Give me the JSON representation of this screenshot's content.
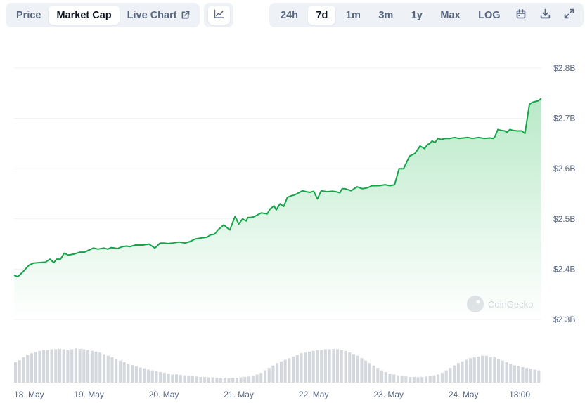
{
  "toolbar": {
    "tabs": [
      {
        "label": "Price",
        "active": false
      },
      {
        "label": "Market Cap",
        "active": true
      },
      {
        "label": "Live Chart",
        "active": false
      }
    ],
    "ranges": [
      {
        "label": "24h",
        "active": false
      },
      {
        "label": "7d",
        "active": true
      },
      {
        "label": "1m",
        "active": false
      },
      {
        "label": "3m",
        "active": false
      },
      {
        "label": "1y",
        "active": false
      },
      {
        "label": "Max",
        "active": false
      }
    ],
    "log_label": "LOG",
    "icons": [
      "line-chart-icon",
      "external-link-icon",
      "calendar-icon",
      "download-icon",
      "expand-icon"
    ]
  },
  "watermark": "CoinGecko",
  "colors": {
    "line": "#16a34a",
    "area_top": "#b4e8c4",
    "volume": "#d4d7dc",
    "grid": "#eef0f3",
    "label": "#58667e"
  },
  "chart_data": {
    "type": "area",
    "y_ticks": [
      {
        "label": "$2.3B",
        "value": 2.3
      },
      {
        "label": "$2.4B",
        "value": 2.4
      },
      {
        "label": "$2.5B",
        "value": 2.5
      },
      {
        "label": "$2.6B",
        "value": 2.6
      },
      {
        "label": "$2.7B",
        "value": 2.7
      },
      {
        "label": "$2.8B",
        "value": 2.8
      }
    ],
    "ylim": [
      2.3,
      2.8
    ],
    "x_ticks": [
      {
        "label": "18. May",
        "t": 0
      },
      {
        "label": "19. May",
        "t": 1
      },
      {
        "label": "20. May",
        "t": 2
      },
      {
        "label": "21. May",
        "t": 3
      },
      {
        "label": "22. May",
        "t": 4
      },
      {
        "label": "23. May",
        "t": 5
      },
      {
        "label": "24. May",
        "t": 6
      },
      {
        "label": "18:00",
        "t": 6.75
      }
    ],
    "x_range": [
      0,
      7.04
    ],
    "grid": true,
    "series": [
      {
        "t": [
          0,
          0.05,
          0.12,
          0.2,
          0.26,
          0.33,
          0.42,
          0.48,
          0.53,
          0.57,
          0.62,
          0.67,
          0.72,
          0.8,
          0.88,
          0.94,
          1.0,
          1.06,
          1.12,
          1.2,
          1.25,
          1.3,
          1.38,
          1.45,
          1.5,
          1.55,
          1.62,
          1.68,
          1.72,
          1.8,
          1.88,
          1.95,
          2.0,
          2.05,
          2.12,
          2.2,
          2.28,
          2.35,
          2.42,
          2.5,
          2.58,
          2.62,
          2.68,
          2.72,
          2.8,
          2.88,
          2.95,
          3.0,
          3.05,
          3.1,
          3.12,
          3.16,
          3.2,
          3.25,
          3.3,
          3.38,
          3.42,
          3.47,
          3.5,
          3.55,
          3.6,
          3.65,
          3.7,
          3.75,
          3.8,
          3.85,
          3.9,
          3.95,
          4.0,
          4.05,
          4.1,
          4.18,
          4.25,
          4.3,
          4.35,
          4.38,
          4.42,
          4.5,
          4.58,
          4.65,
          4.72,
          4.78,
          4.83,
          4.88,
          4.95,
          5.02,
          5.08,
          5.14,
          5.2,
          5.28,
          5.35,
          5.42,
          5.48,
          5.52,
          5.55,
          5.58,
          5.62,
          5.66,
          5.7,
          5.76,
          5.82,
          5.88,
          5.94,
          6.0,
          6.06,
          6.12,
          6.2,
          6.28,
          6.35,
          6.4,
          6.42,
          6.46,
          6.5,
          6.55,
          6.58,
          6.62,
          6.66,
          6.72,
          6.78,
          6.82,
          6.88,
          6.92,
          7.0,
          7.04
        ],
        "values": [
          2.388,
          2.385,
          2.395,
          2.408,
          2.412,
          2.413,
          2.414,
          2.42,
          2.413,
          2.42,
          2.42,
          2.432,
          2.428,
          2.43,
          2.434,
          2.434,
          2.438,
          2.442,
          2.44,
          2.442,
          2.44,
          2.443,
          2.441,
          2.445,
          2.446,
          2.445,
          2.448,
          2.448,
          2.448,
          2.45,
          2.442,
          2.452,
          2.452,
          2.451,
          2.452,
          2.454,
          2.452,
          2.455,
          2.46,
          2.462,
          2.464,
          2.468,
          2.47,
          2.478,
          2.488,
          2.478,
          2.505,
          2.49,
          2.5,
          2.496,
          2.503,
          2.503,
          2.504,
          2.508,
          2.512,
          2.51,
          2.52,
          2.526,
          2.518,
          2.53,
          2.525,
          2.543,
          2.546,
          2.548,
          2.552,
          2.556,
          2.554,
          2.553,
          2.555,
          2.54,
          2.556,
          2.554,
          2.555,
          2.554,
          2.552,
          2.56,
          2.56,
          2.556,
          2.564,
          2.56,
          2.562,
          2.566,
          2.566,
          2.566,
          2.568,
          2.566,
          2.568,
          2.6,
          2.6,
          2.625,
          2.63,
          2.645,
          2.64,
          2.648,
          2.65,
          2.655,
          2.652,
          2.66,
          2.658,
          2.66,
          2.66,
          2.662,
          2.66,
          2.661,
          2.662,
          2.66,
          2.662,
          2.66,
          2.661,
          2.66,
          2.664,
          2.678,
          2.676,
          2.675,
          2.672,
          2.678,
          2.676,
          2.675,
          2.675,
          2.67,
          2.728,
          2.732,
          2.735,
          2.74
        ]
      }
    ],
    "volume_relative": [
      0.5,
      0.55,
      0.62,
      0.68,
      0.72,
      0.75,
      0.78,
      0.8,
      0.8,
      0.82,
      0.82,
      0.83,
      0.82,
      0.8,
      0.82,
      0.84,
      0.83,
      0.82,
      0.8,
      0.78,
      0.76,
      0.74,
      0.7,
      0.66,
      0.62,
      0.58,
      0.54,
      0.5,
      0.46,
      0.43,
      0.4,
      0.37,
      0.35,
      0.32,
      0.3,
      0.28,
      0.26,
      0.24,
      0.22,
      0.2,
      0.2,
      0.19,
      0.18,
      0.17,
      0.16,
      0.15,
      0.14,
      0.14,
      0.13,
      0.13,
      0.12,
      0.12,
      0.12,
      0.11,
      0.12,
      0.12,
      0.13,
      0.14,
      0.15,
      0.17,
      0.2,
      0.24,
      0.3,
      0.36,
      0.42,
      0.48,
      0.52,
      0.56,
      0.6,
      0.64,
      0.68,
      0.72,
      0.74,
      0.76,
      0.78,
      0.8,
      0.8,
      0.82,
      0.82,
      0.83,
      0.82,
      0.8,
      0.78,
      0.74,
      0.7,
      0.66,
      0.6,
      0.54,
      0.48,
      0.42,
      0.36,
      0.3,
      0.26,
      0.22,
      0.2,
      0.18,
      0.16,
      0.15,
      0.14,
      0.14,
      0.13,
      0.14,
      0.15,
      0.16,
      0.18,
      0.2,
      0.24,
      0.3,
      0.36,
      0.42,
      0.48,
      0.52,
      0.56,
      0.6,
      0.62,
      0.64,
      0.66,
      0.66,
      0.64,
      0.62,
      0.58,
      0.54,
      0.5,
      0.46,
      0.42,
      0.4,
      0.38,
      0.36,
      0.34,
      0.32,
      0.3
    ]
  }
}
